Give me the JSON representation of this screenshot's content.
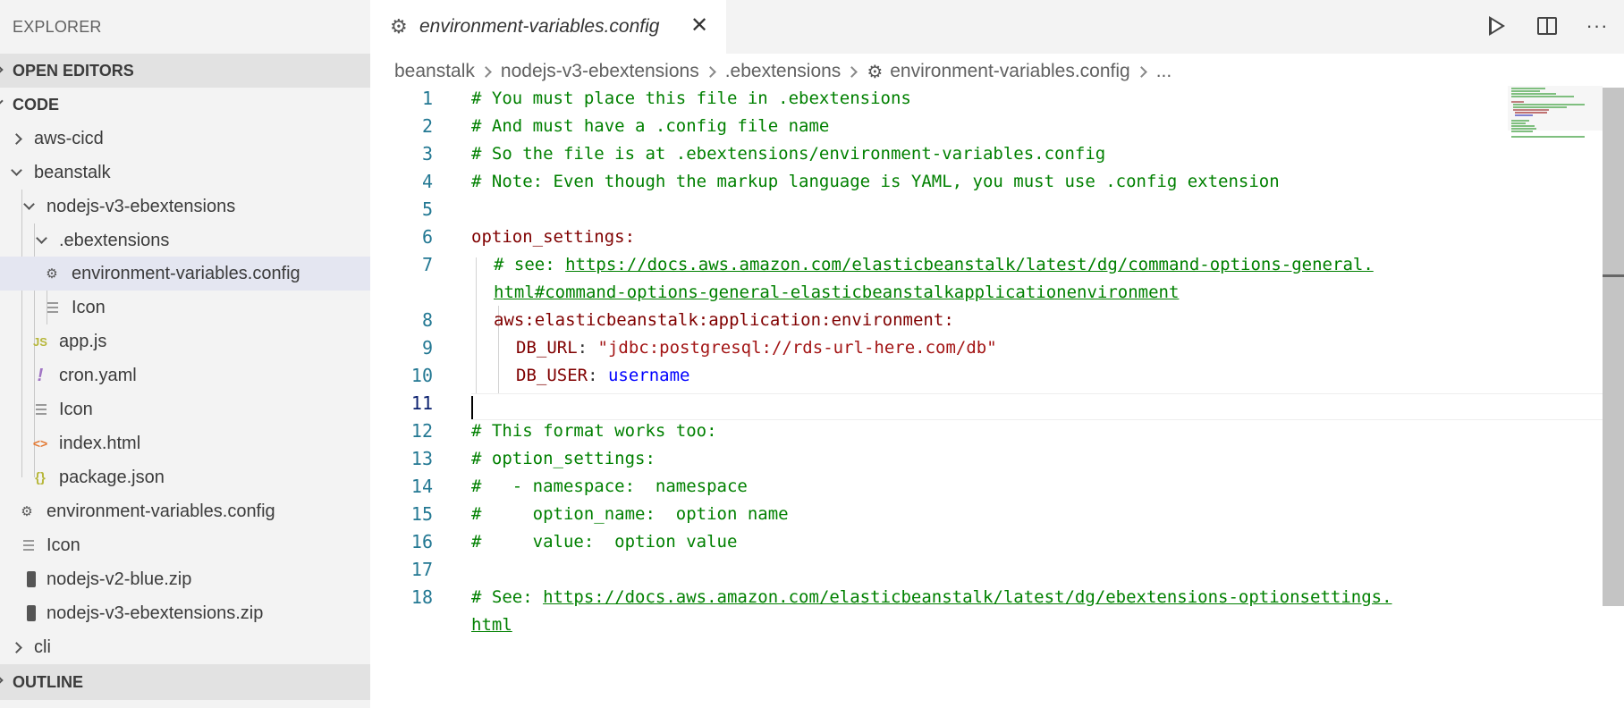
{
  "sidebar": {
    "title": "EXPLORER",
    "sections": {
      "open_editors": "OPEN EDITORS",
      "code": "CODE",
      "outline": "OUTLINE"
    },
    "tree": [
      {
        "label": "aws-cicd"
      },
      {
        "label": "beanstalk"
      },
      {
        "label": "nodejs-v3-ebextensions"
      },
      {
        "label": ".ebextensions"
      },
      {
        "label": "environment-variables.config"
      },
      {
        "label": "Icon"
      },
      {
        "label": "app.js"
      },
      {
        "label": "cron.yaml"
      },
      {
        "label": "Icon"
      },
      {
        "label": "index.html"
      },
      {
        "label": "package.json"
      },
      {
        "label": "environment-variables.config"
      },
      {
        "label": "Icon"
      },
      {
        "label": "nodejs-v2-blue.zip"
      },
      {
        "label": "nodejs-v3-ebextensions.zip"
      },
      {
        "label": "cli"
      }
    ],
    "icons": {
      "js": "JS",
      "yaml": "!",
      "html": "<>",
      "json": "{}"
    }
  },
  "tab": {
    "label": "environment-variables.config",
    "close": "✕"
  },
  "toolbar": {
    "more": "···"
  },
  "breadcrumb": [
    "beanstalk",
    "nodejs-v3-ebextensions",
    ".ebextensions",
    "environment-variables.config",
    "..."
  ],
  "editor": {
    "line_numbers": [
      "1",
      "2",
      "3",
      "4",
      "5",
      "6",
      "7",
      "",
      "8",
      "9",
      "10",
      "11",
      "12",
      "13",
      "14",
      "15",
      "16",
      "17",
      "18",
      ""
    ],
    "lines": {
      "l1": "# You must place this file in .ebextensions",
      "l2": "# And must have a .config file name",
      "l3": "# So the file is at .ebextensions/environment-variables.config",
      "l4": "# Note: Even though the markup language is YAML, you must use .config extension",
      "l6": "option_settings:",
      "l7_prefix": "# see: ",
      "l7_link_a": "https://docs.aws.amazon.com/elasticbeanstalk/latest/dg/command-options-general.",
      "l7_link_b": "html#command-options-general-elasticbeanstalkapplicationenvironment",
      "l8": "aws:elasticbeanstalk:application:environment:",
      "l9_key": "DB_URL",
      "l9_val": "\"jdbc:postgresql://rds-url-here.com/db\"",
      "l10_key": "DB_USER",
      "l10_val": "username",
      "l12": "# This format works too:",
      "l13": "# option_settings:",
      "l14": "#   - namespace:  namespace",
      "l15": "#     option_name:  option name",
      "l16": "#     value:  option value",
      "l18_prefix": "# See: ",
      "l18_link_a": "https://docs.aws.amazon.com/elasticbeanstalk/latest/dg/ebextensions-optionsettings.",
      "l18_link_b": "html"
    },
    "punct": {
      "colon": ": "
    }
  }
}
